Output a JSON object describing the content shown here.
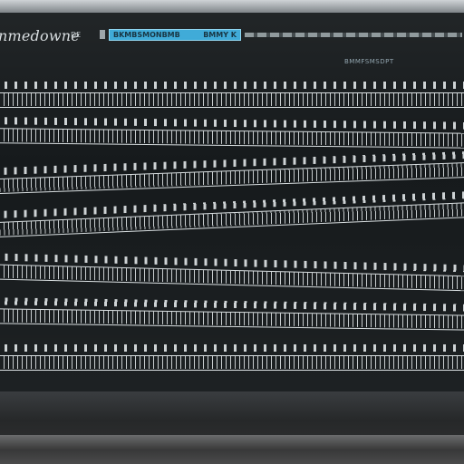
{
  "app": {
    "name": "nmedowne",
    "tag": "DE",
    "active_tab_left": "BKMBSMONBMB",
    "active_tab_right": "BMMY K",
    "top_right_info": "BMMFSMSDPT"
  },
  "colors": {
    "tab_accent": "#37a7d6",
    "screen_bg": "#161a1c",
    "ink": "#d9dfe1"
  },
  "score": {
    "row_count": 7
  }
}
